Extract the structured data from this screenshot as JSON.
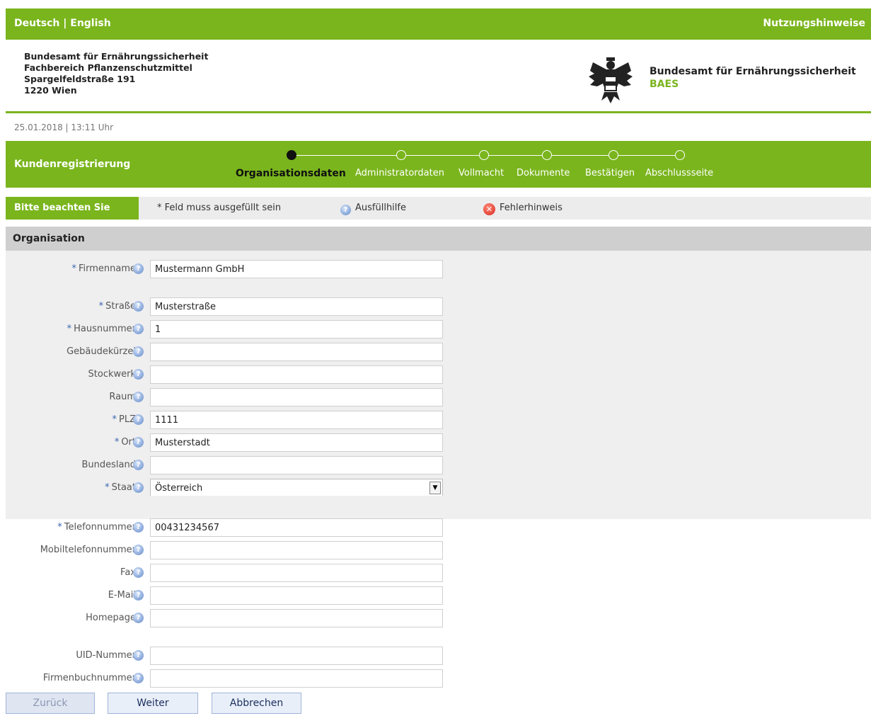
{
  "topbar": {
    "lang_de": "Deutsch",
    "separator": "|",
    "lang_en": "English",
    "usage_link": "Nutzungshinweise"
  },
  "header": {
    "address": [
      "Bundesamt für Ernährungssicherheit",
      "Fachbereich Pflanzenschutzmittel",
      "Spargelfeldstraße 191",
      "1220 Wien"
    ],
    "agency_name": "Bundesamt für Ernährungssicherheit",
    "agency_abbr": "BAES"
  },
  "datetime": "25.01.2018 | 13:11 Uhr",
  "wizard": {
    "title": "Kundenregistrierung",
    "steps": [
      "Organisationsdaten",
      "Administratordaten",
      "Vollmacht",
      "Dokumente",
      "Bestätigen",
      "Abschlussseite"
    ],
    "active_step": 0
  },
  "notice": {
    "label": "Bitte beachten Sie",
    "required_text": "* Feld muss ausgefüllt sein",
    "help_text": "Ausfüllhilfe",
    "error_text": "Fehlerhinweis"
  },
  "section_title": "Organisation",
  "fields": {
    "firmenname": {
      "label": "Firmenname",
      "required": "*",
      "value": "Mustermann GmbH"
    },
    "strasse": {
      "label": "Straße",
      "required": "*",
      "value": "Musterstraße"
    },
    "hausnummer": {
      "label": "Hausnummer",
      "required": "*",
      "value": "1"
    },
    "gebaeudekuerzel": {
      "label": "Gebäudekürzel",
      "value": ""
    },
    "stockwerk": {
      "label": "Stockwerk",
      "value": ""
    },
    "raum": {
      "label": "Raum",
      "value": ""
    },
    "plz": {
      "label": "PLZ",
      "required": "*",
      "value": "1111"
    },
    "ort": {
      "label": "Ort",
      "required": "*",
      "value": "Musterstadt"
    },
    "bundesland": {
      "label": "Bundesland",
      "value": ""
    },
    "staat": {
      "label": "Staat",
      "required": "*",
      "value": "Österreich"
    },
    "telefon": {
      "label": "Telefonnummer",
      "required": "*",
      "value": "00431234567"
    },
    "mobil": {
      "label": "Mobiltelefonnummer",
      "value": ""
    },
    "fax": {
      "label": "Fax",
      "value": ""
    },
    "email": {
      "label": "E-Mail",
      "value": ""
    },
    "homepage": {
      "label": "Homepage",
      "value": ""
    },
    "uid": {
      "label": "UID-Nummer",
      "value": ""
    },
    "firmenbuch": {
      "label": "Firmenbuchnummer",
      "value": ""
    }
  },
  "buttons": {
    "back": "Zurück",
    "next": "Weiter",
    "cancel": "Abbrechen"
  }
}
